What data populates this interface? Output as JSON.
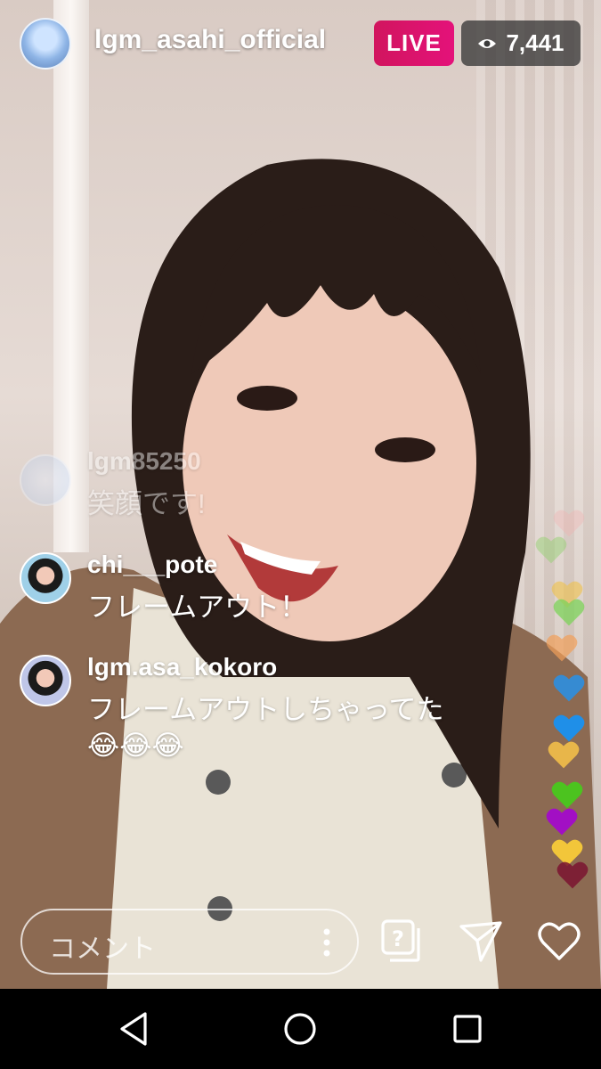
{
  "header": {
    "username": "lgm_asahi_official",
    "live_label": "LIVE",
    "viewer_count": "7,441"
  },
  "comments": [
    {
      "username": "lgm85250",
      "text": "笑顔です!",
      "faded": true
    },
    {
      "username": "chi___pote",
      "text": "フレームアウト！"
    },
    {
      "username": "lgm.asa_kokoro",
      "text": "フレームアウトしちゃってた",
      "emoji": "😂😂😂"
    }
  ],
  "composer": {
    "placeholder": "コメント"
  },
  "icons": {
    "viewer": "eye-icon",
    "question": "question-box-icon",
    "share": "paper-plane-icon",
    "like": "heart-outline-icon",
    "nav_back": "triangle-back-icon",
    "nav_home": "circle-home-icon",
    "nav_recent": "square-recents-icon"
  },
  "colors": {
    "live": "#e4127a",
    "viewer_badge_bg": "#3a3a3a"
  },
  "hearts": [
    "#f4b0b0",
    "#8fd16a",
    "#f0c24a",
    "#7dd35a",
    "#f2a05a",
    "#2d8fe0",
    "#1f8fe8",
    "#e8b64a",
    "#4cc31f",
    "#a20fc4",
    "#f2c63a",
    "#7b1430"
  ]
}
